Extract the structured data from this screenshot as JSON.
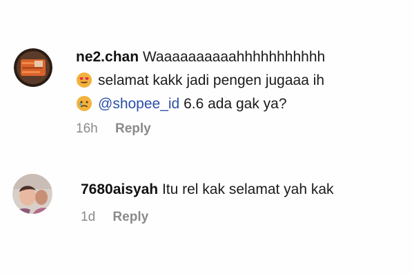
{
  "comments": [
    {
      "username": "ne2.chan",
      "line1": "Waaaaaaaaaahhhhhhhhhhh",
      "line2": "selamat kakk jadi pengen jugaaa ih",
      "mention": "@shopee_id",
      "line3_rest": " 6.6 ada gak ya?",
      "time": "16h",
      "reply_label": "Reply",
      "emoji_1": "heart-eyes-emoji",
      "emoji_2": "sad-face-emoji"
    },
    {
      "username": "7680aisyah",
      "text": "Itu rel kak selamat yah kak",
      "time": "1d",
      "reply_label": "Reply"
    }
  ]
}
